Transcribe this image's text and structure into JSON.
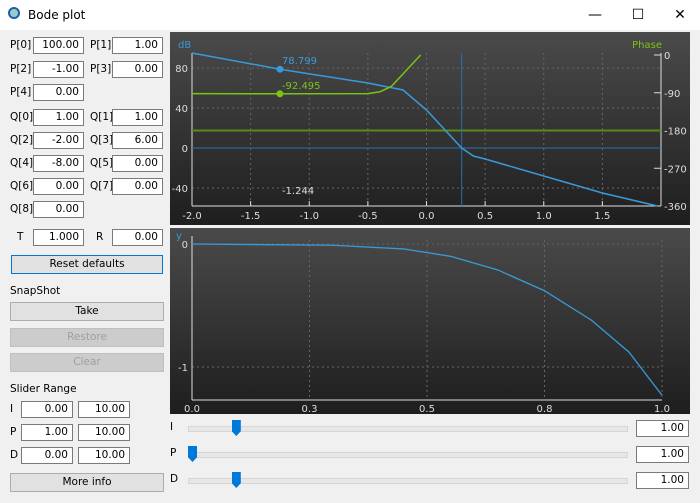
{
  "window": {
    "title": "Bode plot",
    "minimize": "—",
    "maximize": "☐",
    "close": "✕"
  },
  "params": {
    "P": [
      {
        "label": "P[0]",
        "value": "100.00"
      },
      {
        "label": "P[1]",
        "value": "1.00"
      },
      {
        "label": "P[2]",
        "value": "-1.00"
      },
      {
        "label": "P[3]",
        "value": "0.00"
      },
      {
        "label": "P[4]",
        "value": "0.00"
      }
    ],
    "Q": [
      {
        "label": "Q[0]",
        "value": "1.00"
      },
      {
        "label": "Q[1]",
        "value": "1.00"
      },
      {
        "label": "Q[2]",
        "value": "-2.00"
      },
      {
        "label": "Q[3]",
        "value": "6.00"
      },
      {
        "label": "Q[4]",
        "value": "-8.00"
      },
      {
        "label": "Q[5]",
        "value": "0.00"
      },
      {
        "label": "Q[6]",
        "value": "0.00"
      },
      {
        "label": "Q[7]",
        "value": "0.00"
      },
      {
        "label": "Q[8]",
        "value": "0.00"
      }
    ],
    "T": {
      "label": "T",
      "value": "1.000"
    },
    "R": {
      "label": "R",
      "value": "0.00"
    }
  },
  "reset_label": "Reset defaults",
  "snapshot": {
    "title": "SnapShot",
    "take": "Take",
    "restore": "Restore",
    "clear": "Clear"
  },
  "slider_range": {
    "title": "Slider Range",
    "rows": [
      {
        "label": "I",
        "min": "0.00",
        "max": "10.00"
      },
      {
        "label": "P",
        "min": "1.00",
        "max": "10.00"
      },
      {
        "label": "D",
        "min": "0.00",
        "max": "10.00"
      }
    ]
  },
  "more_info": "More info",
  "sliders": [
    {
      "label": "I",
      "value": "1.00",
      "fraction": 0.1
    },
    {
      "label": "P",
      "value": "1.00",
      "fraction": 0.0
    },
    {
      "label": "D",
      "value": "1.00",
      "fraction": 0.1
    }
  ],
  "chart_data": [
    {
      "type": "line",
      "ylabel": "dB",
      "y2label": "Phase",
      "xlim": [
        -2.0,
        2.0
      ],
      "ylim": [
        -58,
        95
      ],
      "y2lim": [
        -360,
        0
      ],
      "xticks": [
        "-2.0",
        "-1.5",
        "-1.0",
        "-0.5",
        "0.0",
        "0.5",
        "1.0",
        "1.5"
      ],
      "yticks": [
        "80",
        "40",
        "0",
        "-40"
      ],
      "y2ticks": [
        "0",
        "-90",
        "-180",
        "-270",
        "-360"
      ],
      "grid": true,
      "colors": {
        "magnitude": "#3a9ad9",
        "phase": "#7cc412"
      },
      "magnitude": [
        [
          -2,
          95
        ],
        [
          -1.25,
          78.8
        ],
        [
          -0.5,
          65
        ],
        [
          -0.2,
          58
        ],
        [
          0,
          38
        ],
        [
          0.3,
          0
        ],
        [
          0.4,
          -8
        ],
        [
          0.5,
          -11
        ],
        [
          1.0,
          -28
        ],
        [
          1.5,
          -45
        ],
        [
          1.97,
          -58
        ]
      ],
      "phase": [
        [
          -2,
          -92
        ],
        [
          -1.25,
          -92.5
        ],
        [
          -0.5,
          -92
        ],
        [
          -0.4,
          -88
        ],
        [
          -0.3,
          -75
        ],
        [
          -0.2,
          -45
        ],
        [
          -0.1,
          -15
        ],
        [
          -0.05,
          0
        ]
      ],
      "marker_x": -1.25,
      "marker_mag_label": "78.799",
      "marker_phase_label": "-92.495",
      "crosshair_label": "-1.244",
      "hline_db": 0,
      "hline_phase": -180,
      "vline_x": 0.3
    },
    {
      "type": "line",
      "ylabel": "y",
      "xlim": [
        0,
        1
      ],
      "ylim": [
        -1.23,
        0.02
      ],
      "xticks": [
        "0.0",
        "0.3",
        "0.5",
        "0.8",
        "1.0"
      ],
      "yticks": [
        "0",
        "-1"
      ],
      "grid": true,
      "color": "#3a9ad9",
      "values": [
        [
          0,
          0
        ],
        [
          0.3,
          -0.01
        ],
        [
          0.45,
          -0.04
        ],
        [
          0.55,
          -0.1
        ],
        [
          0.65,
          -0.21
        ],
        [
          0.75,
          -0.38
        ],
        [
          0.85,
          -0.62
        ],
        [
          0.93,
          -0.88
        ],
        [
          1.0,
          -1.23
        ]
      ]
    }
  ]
}
